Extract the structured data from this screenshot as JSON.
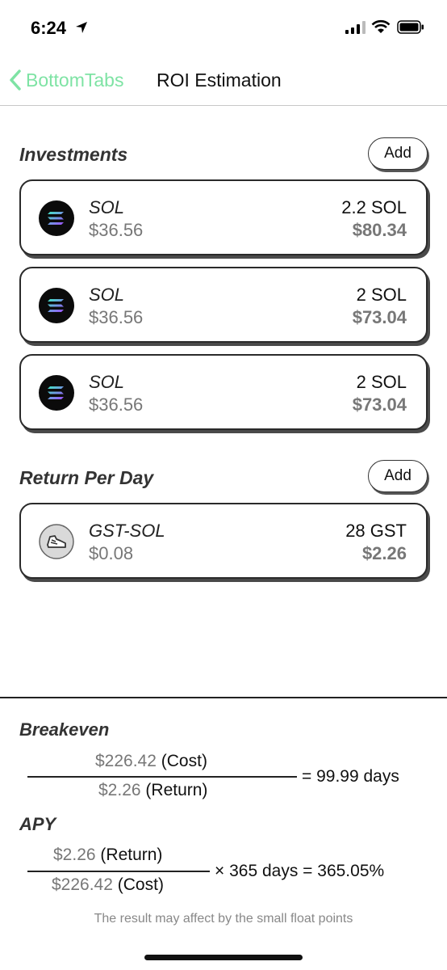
{
  "status": {
    "time": "6:24"
  },
  "nav": {
    "back_label": "BottomTabs",
    "title": "ROI Estimation"
  },
  "investments": {
    "title": "Investments",
    "add_label": "Add",
    "items": [
      {
        "name": "SOL",
        "price": "$36.56",
        "amount": "2.2 SOL",
        "value": "$80.34"
      },
      {
        "name": "SOL",
        "price": "$36.56",
        "amount": "2 SOL",
        "value": "$73.04"
      },
      {
        "name": "SOL",
        "price": "$36.56",
        "amount": "2 SOL",
        "value": "$73.04"
      }
    ]
  },
  "returns": {
    "title": "Return Per Day",
    "add_label": "Add",
    "items": [
      {
        "name": "GST-SOL",
        "price": "$0.08",
        "amount": "28 GST",
        "value": "$2.26"
      }
    ]
  },
  "breakeven": {
    "title": "Breakeven",
    "num_value": "$226.42",
    "num_label": "(Cost)",
    "den_value": "$2.26",
    "den_label": "(Return)",
    "result": "= 99.99 days"
  },
  "apy": {
    "title": "APY",
    "num_value": "$2.26",
    "num_label": "(Return)",
    "den_value": "$226.42",
    "den_label": "(Cost)",
    "result": "× 365 days = 365.05%"
  },
  "note": "The result may affect by the small float points",
  "colors": {
    "accent": "#7ee3a4",
    "text": "#111111",
    "muted": "#777777"
  },
  "icons": {
    "investment_token": "solana-icon",
    "return_token": "gst-shoe-icon"
  }
}
